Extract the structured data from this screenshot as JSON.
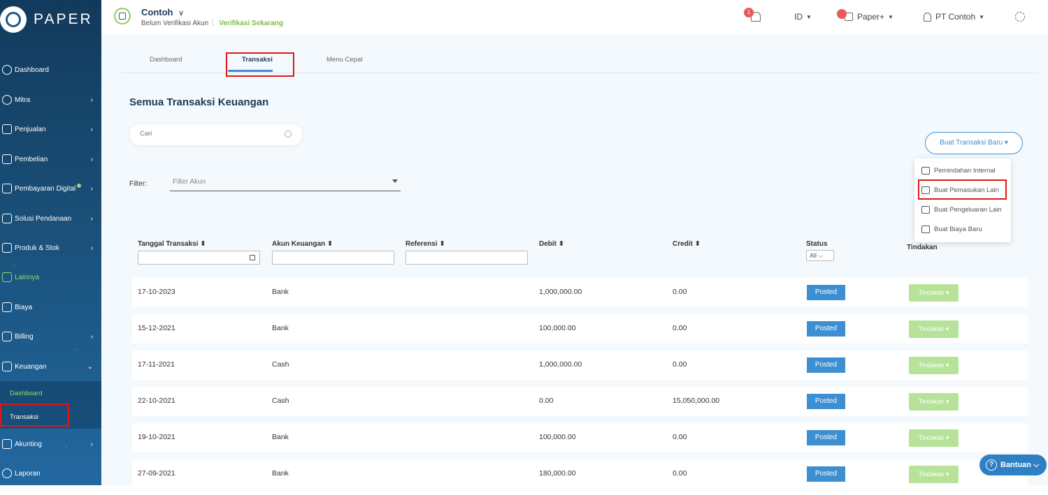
{
  "brand": {
    "name": "PAPER"
  },
  "sidebar": {
    "items": [
      {
        "label": "Dashboard",
        "chevron": ""
      },
      {
        "label": "Mitra",
        "chevron": "›"
      },
      {
        "label": "Penjualan",
        "chevron": "›"
      },
      {
        "label": "Pembelian",
        "chevron": "›"
      },
      {
        "label": "Pembayaran Digital",
        "chevron": "›"
      },
      {
        "label": "Solusi Pendanaan",
        "chevron": "›"
      },
      {
        "label": "Produk & Stok",
        "chevron": "›"
      },
      {
        "label": "Lainnya",
        "chevron": ""
      },
      {
        "label": "Biaya",
        "chevron": ""
      },
      {
        "label": "Billing",
        "chevron": "›"
      },
      {
        "label": "Keuangan",
        "chevron": "⌄"
      },
      {
        "label": "Akunting",
        "chevron": "›"
      },
      {
        "label": "Laporan",
        "chevron": ""
      }
    ],
    "sub_items": [
      "Dashboard",
      "Transaksi"
    ]
  },
  "header": {
    "company": "Contoh",
    "company_caret": "∨",
    "verify_status": "Belum Verifikasi Akun",
    "verify_link": "Verifikasi Sekarang",
    "notif_count": "1",
    "language": "ID",
    "paper_plus": "Paper+",
    "user": "PT Contoh",
    "caret": "▼"
  },
  "tabs": [
    "Dashboard",
    "Transaksi",
    "Menu Cepat"
  ],
  "page": {
    "title": "Semua Transaksi Keuangan",
    "search_placeholder": "Cari",
    "filter_label": "Filter:",
    "filter_placeholder": "Filter Akun",
    "new_button": "Buat Transaksi Baru ▾"
  },
  "new_menu": [
    "Pemindahan Internal",
    "Buat Pemasukan Lain",
    "Buat Pengeluaran Lain",
    "Buat Biaya Baru"
  ],
  "table": {
    "headers": [
      "Tanggal Transaksi ⬍",
      "Akun Keuangan ⬍",
      "Referensi ⬍",
      "Debit ⬍",
      "Credit ⬍",
      "Status",
      "Tindakan"
    ],
    "status_filter": "All ⌵",
    "rows": [
      {
        "date": "17-10-2023",
        "account": "Bank",
        "ref": "",
        "debit": "1,000,000.00",
        "credit": "0.00",
        "status": "Posted",
        "action": "Tindakan ▾"
      },
      {
        "date": "15-12-2021",
        "account": "Bank",
        "ref": "",
        "debit": "100,000.00",
        "credit": "0.00",
        "status": "Posted",
        "action": "Tindakan ▾"
      },
      {
        "date": "17-11-2021",
        "account": "Cash",
        "ref": "",
        "debit": "1,000,000.00",
        "credit": "0.00",
        "status": "Posted",
        "action": "Tindakan ▾"
      },
      {
        "date": "22-10-2021",
        "account": "Cash",
        "ref": "",
        "debit": "0.00",
        "credit": "15,050,000.00",
        "status": "Posted",
        "action": "Tindakan ▾"
      },
      {
        "date": "19-10-2021",
        "account": "Bank",
        "ref": "",
        "debit": "100,000.00",
        "credit": "0.00",
        "status": "Posted",
        "action": "Tindakan ▾"
      },
      {
        "date": "27-09-2021",
        "account": "Bank",
        "ref": "",
        "debit": "180,000.00",
        "credit": "0.00",
        "status": "Posted",
        "action": "Tindakan ▾"
      }
    ]
  },
  "help": {
    "icon": "?",
    "label": "Bantuan ⌵"
  },
  "colors": {
    "accent": "#3c8fd2",
    "green": "#7ac142",
    "highlight": "#e01818"
  }
}
